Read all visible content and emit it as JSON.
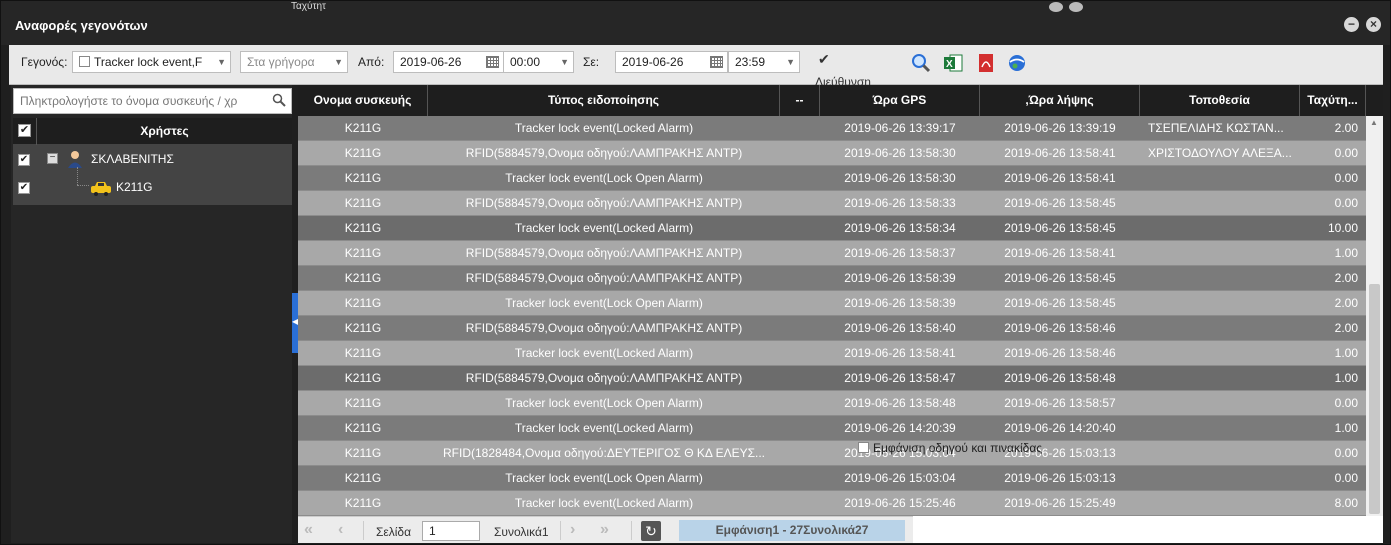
{
  "window": {
    "title": "Αναφορές γεγονότων",
    "bg_fragment": "Ταχύτητ"
  },
  "toolbar": {
    "event_label": "Γεγονός:",
    "event_value": "Tracker lock event,F",
    "quick_placeholder": "Στα γρήγορα",
    "from_label": "Από:",
    "from_date": "2019-06-26",
    "from_time": "00:00",
    "to_label": "Σε:",
    "to_date": "2019-06-26",
    "to_time": "23:59",
    "direction_label": "Διεύθυνση",
    "icons": [
      "search-icon",
      "excel-icon",
      "pdf-icon",
      "google-earth-icon"
    ]
  },
  "left": {
    "search_placeholder": "Πληκτρολογήστε το όνομα συσκευής / χρ",
    "header": "Χρήστες",
    "group": "ΣΚΛΑΒΕΝΙΤΗΣ",
    "device": "K211G"
  },
  "grid": {
    "columns": [
      "Ονομα συσκευής",
      "Τύπος ειδοποίησης",
      "--",
      "Ώρα GPS",
      ",Ώρα λήψης",
      "Τοποθεσία",
      "Ταχύτη..."
    ],
    "rows": [
      {
        "device": "K211G",
        "type": "Tracker lock event(Locked Alarm)",
        "extra": "",
        "gps": "2019-06-26 13:39:17",
        "recv": "2019-06-26 13:39:19",
        "loc": "ΤΣΕΠΕΛΙΔΗΣ ΚΩΣΤΑΝ...",
        "speed": "2.00"
      },
      {
        "device": "K211G",
        "type": "RFID(5884579,Ονομα οδηγού:ΛΑΜΠΡΑΚΗΣ ΑΝΤΡ)",
        "extra": "",
        "gps": "2019-06-26 13:58:30",
        "recv": "2019-06-26 13:58:41",
        "loc": "ΧΡΙΣΤΟΔΟΥΛΟΥ ΑΛΕΞΑ...",
        "speed": "0.00"
      },
      {
        "device": "K211G",
        "type": "Tracker lock event(Lock Open Alarm)",
        "extra": "",
        "gps": "2019-06-26 13:58:30",
        "recv": "2019-06-26 13:58:41",
        "loc": "",
        "speed": "0.00"
      },
      {
        "device": "K211G",
        "type": "RFID(5884579,Ονομα οδηγού:ΛΑΜΠΡΑΚΗΣ ΑΝΤΡ)",
        "extra": "",
        "gps": "2019-06-26 13:58:33",
        "recv": "2019-06-26 13:58:45",
        "loc": "",
        "speed": "0.00"
      },
      {
        "device": "K211G",
        "type": "Tracker lock event(Locked Alarm)",
        "extra": "",
        "gps": "2019-06-26 13:58:34",
        "recv": "2019-06-26 13:58:45",
        "loc": "",
        "speed": "10.00"
      },
      {
        "device": "K211G",
        "type": "RFID(5884579,Ονομα οδηγού:ΛΑΜΠΡΑΚΗΣ ΑΝΤΡ)",
        "extra": "",
        "gps": "2019-06-26 13:58:37",
        "recv": "2019-06-26 13:58:41",
        "loc": "",
        "speed": "1.00"
      },
      {
        "device": "K211G",
        "type": "RFID(5884579,Ονομα οδηγού:ΛΑΜΠΡΑΚΗΣ ΑΝΤΡ)",
        "extra": "",
        "gps": "2019-06-26 13:58:39",
        "recv": "2019-06-26 13:58:45",
        "loc": "",
        "speed": "2.00"
      },
      {
        "device": "K211G",
        "type": "Tracker lock event(Lock Open Alarm)",
        "extra": "",
        "gps": "2019-06-26 13:58:39",
        "recv": "2019-06-26 13:58:45",
        "loc": "",
        "speed": "2.00"
      },
      {
        "device": "K211G",
        "type": "RFID(5884579,Ονομα οδηγού:ΛΑΜΠΡΑΚΗΣ ΑΝΤΡ)",
        "extra": "",
        "gps": "2019-06-26 13:58:40",
        "recv": "2019-06-26 13:58:46",
        "loc": "",
        "speed": "2.00"
      },
      {
        "device": "K211G",
        "type": "Tracker lock event(Locked Alarm)",
        "extra": "",
        "gps": "2019-06-26 13:58:41",
        "recv": "2019-06-26 13:58:46",
        "loc": "",
        "speed": "1.00"
      },
      {
        "device": "K211G",
        "type": "RFID(5884579,Ονομα οδηγού:ΛΑΜΠΡΑΚΗΣ ΑΝΤΡ)",
        "extra": "",
        "gps": "2019-06-26 13:58:47",
        "recv": "2019-06-26 13:58:48",
        "loc": "",
        "speed": "1.00"
      },
      {
        "device": "K211G",
        "type": "Tracker lock event(Lock Open Alarm)",
        "extra": "",
        "gps": "2019-06-26 13:58:48",
        "recv": "2019-06-26 13:58:57",
        "loc": "",
        "speed": "0.00"
      },
      {
        "device": "K211G",
        "type": "Tracker lock event(Locked Alarm)",
        "extra": "",
        "gps": "2019-06-26 14:20:39",
        "recv": "2019-06-26 14:20:40",
        "loc": "",
        "speed": "1.00"
      },
      {
        "device": "K211G",
        "type": "RFID(1828484,Ονομα οδηγού:ΔΕΥΤΕΡΙΓΟΣ Θ ΚΔ ΕΛΕΥΣ...",
        "extra": "",
        "gps": "2019-06-26 15:03:04",
        "recv": "2019-06-26 15:03:13",
        "loc": "",
        "speed": "0.00"
      },
      {
        "device": "K211G",
        "type": "Tracker lock event(Lock Open Alarm)",
        "extra": "",
        "gps": "2019-06-26 15:03:04",
        "recv": "2019-06-26 15:03:13",
        "loc": "",
        "speed": "0.00"
      },
      {
        "device": "K211G",
        "type": "Tracker lock event(Locked Alarm)",
        "extra": "",
        "gps": "2019-06-26 15:25:46",
        "recv": "2019-06-26 15:25:49",
        "loc": "",
        "speed": "8.00"
      }
    ]
  },
  "pager": {
    "page_label": "Σελίδα",
    "page_value": "1",
    "total_label": "Συνολικά1",
    "display_text": "Εμφάνιση1 - 27Συνολικά27"
  },
  "options": {
    "show_driver_plate": "Εμφάνιση οδηγού και πινακίδας"
  },
  "colors": {
    "accent": "#2a6fd6",
    "header": "#1e1e1e",
    "row_dark": "#7b7b7b",
    "row_light": "#a8a8a8"
  }
}
